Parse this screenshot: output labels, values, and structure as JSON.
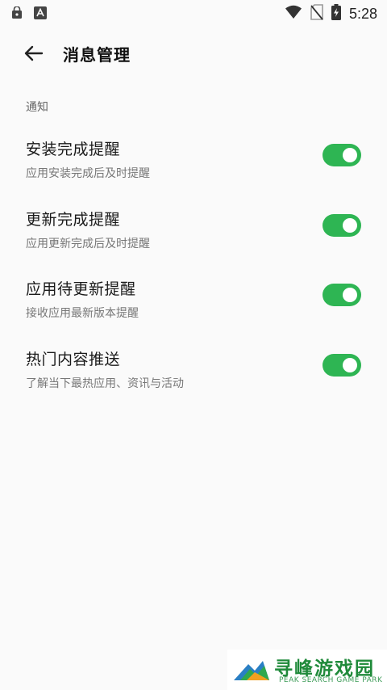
{
  "status_bar": {
    "time": "5:28",
    "icons": [
      "lock-app-icon",
      "a-app-icon",
      "wifi-icon",
      "no-sim-icon",
      "battery-charging-icon"
    ]
  },
  "app_bar": {
    "back_icon": "arrow-left-icon",
    "title": "消息管理"
  },
  "section": {
    "header": "通知"
  },
  "settings": [
    {
      "title": "安装完成提醒",
      "description": "应用安装完成后及时提醒",
      "enabled": true
    },
    {
      "title": "更新完成提醒",
      "description": "应用更新完成后及时提醒",
      "enabled": true
    },
    {
      "title": "应用待更新提醒",
      "description": "接收应用最新版本提醒",
      "enabled": true
    },
    {
      "title": "热门内容推送",
      "description": "了解当下最热应用、资讯与活动",
      "enabled": true
    }
  ],
  "colors": {
    "toggle_on": "#2eb553",
    "background": "#fafafa"
  },
  "watermark": {
    "title": "寻峰游戏园",
    "subtitle": "PEAK SEARCH GAME PARK"
  }
}
